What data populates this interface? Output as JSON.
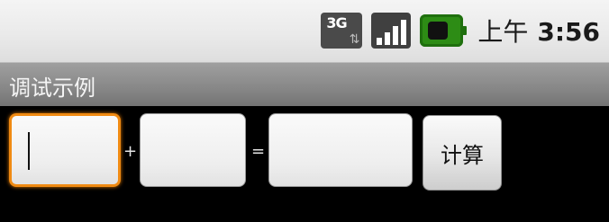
{
  "status_bar": {
    "network_label": "3G",
    "network_activity_glyph": "⇅",
    "signal_icon": "signal-strength-icon",
    "battery_icon": "battery-charging-icon",
    "ampm": "上午",
    "time": "3:56"
  },
  "title_bar": {
    "title": "调试示例"
  },
  "form": {
    "operand1_value": "",
    "operand2_value": "",
    "result_value": "",
    "plus_sign": "+",
    "equals_sign": "=",
    "calc_button_label": "计算"
  },
  "colors": {
    "focus_border": "#f08a12",
    "title_bar": "#8b8b8b",
    "background": "#000000",
    "battery": "#2d8c15"
  }
}
